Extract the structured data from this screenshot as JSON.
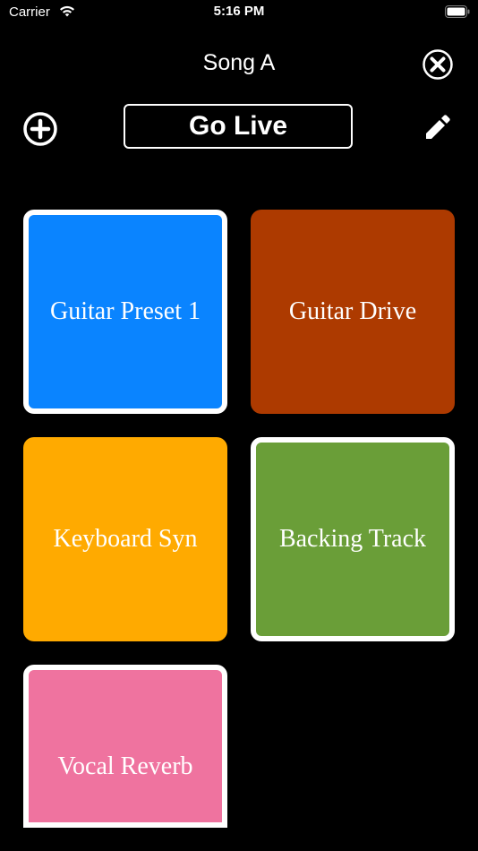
{
  "status_bar": {
    "carrier": "Carrier",
    "time": "5:16 PM"
  },
  "header": {
    "title": "Song A",
    "go_live_label": "Go Live"
  },
  "icons": {
    "close": "close-circle-icon",
    "add": "add-circle-icon",
    "edit": "pencil-icon"
  },
  "colors": {
    "background": "#000000",
    "tile_1": "#0A84FF",
    "tile_2": "#AD3A00",
    "tile_3": "#FFAA00",
    "tile_4": "#6A9E38",
    "tile_5": "#EF739F"
  },
  "tiles": [
    {
      "label": "Guitar Preset 1",
      "selected": true
    },
    {
      "label": "Guitar Drive",
      "selected": false
    },
    {
      "label": "Keyboard Syn",
      "selected": false
    },
    {
      "label": "Backing Track",
      "selected": true
    },
    {
      "label": "Vocal Reverb",
      "selected": true
    }
  ]
}
